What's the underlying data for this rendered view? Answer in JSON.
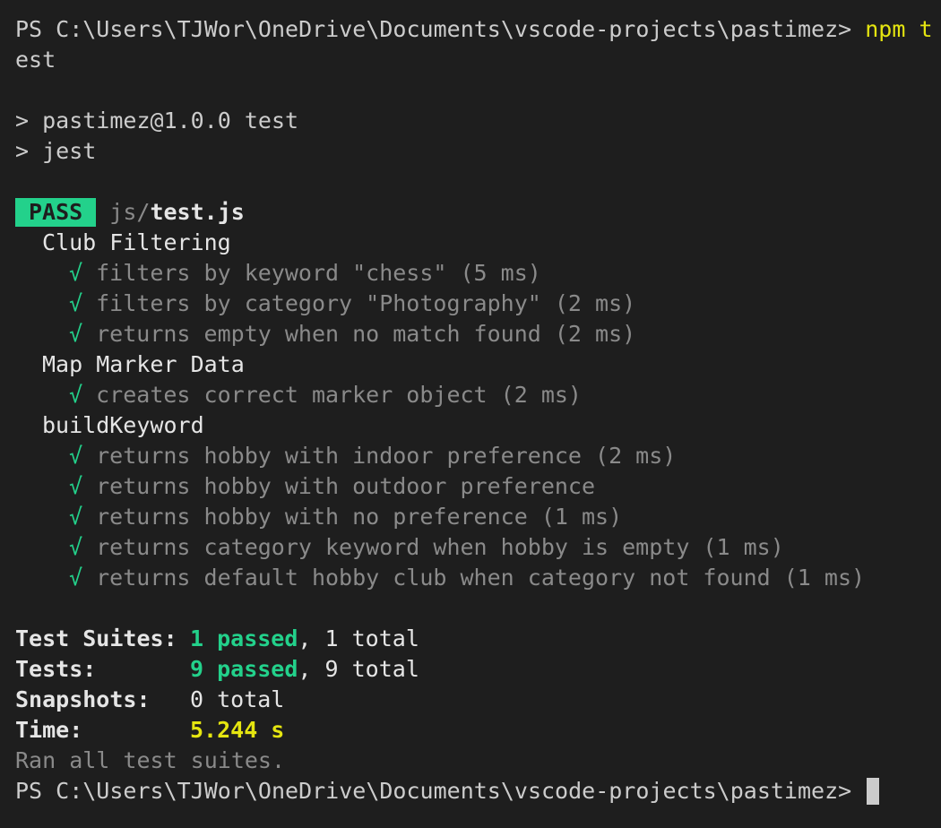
{
  "terminal": {
    "prompt": "PS C:\\Users\\TJWor\\OneDrive\\Documents\\vscode-projects\\pastimez>",
    "command_part1": "npm t",
    "command_part2": "est",
    "npm_script_line": "> pastimez@1.0.0 test",
    "jest_line": "> jest",
    "pass_badge": "PASS",
    "file_dir": "js/",
    "file_name": "test.js",
    "check_mark": "√",
    "groups": [
      {
        "name": "Club Filtering",
        "tests": [
          "filters by keyword \"chess\" (5 ms)",
          "filters by category \"Photography\" (2 ms)",
          "returns empty when no match found (2 ms)"
        ]
      },
      {
        "name": "Map Marker Data",
        "tests": [
          "creates correct marker object (2 ms)"
        ]
      },
      {
        "name": "buildKeyword",
        "tests": [
          "returns hobby with indoor preference (2 ms)",
          "returns hobby with outdoor preference",
          "returns hobby with no preference (1 ms)",
          "returns category keyword when hobby is empty (1 ms)",
          "returns default hobby club when category not found (1 ms)"
        ]
      }
    ],
    "summary": {
      "suites_label": "Test Suites:",
      "suites_passed": "1 passed",
      "suites_total": ", 1 total",
      "tests_label": "Tests:",
      "tests_passed": "9 passed",
      "tests_total": ", 9 total",
      "snapshots_label": "Snapshots:",
      "snapshots_total": "0 total",
      "time_label": "Time:",
      "time_value": "5.244 s",
      "ran_all": "Ran all test suites."
    },
    "final_prompt": "PS C:\\Users\\TJWor\\OneDrive\\Documents\\vscode-projects\\pastimez>"
  },
  "colors": {
    "background": "#1e1e1e",
    "text": "#cccccc",
    "green": "#23d18b",
    "yellow": "#e5e510",
    "dim": "#8a8a8a"
  }
}
